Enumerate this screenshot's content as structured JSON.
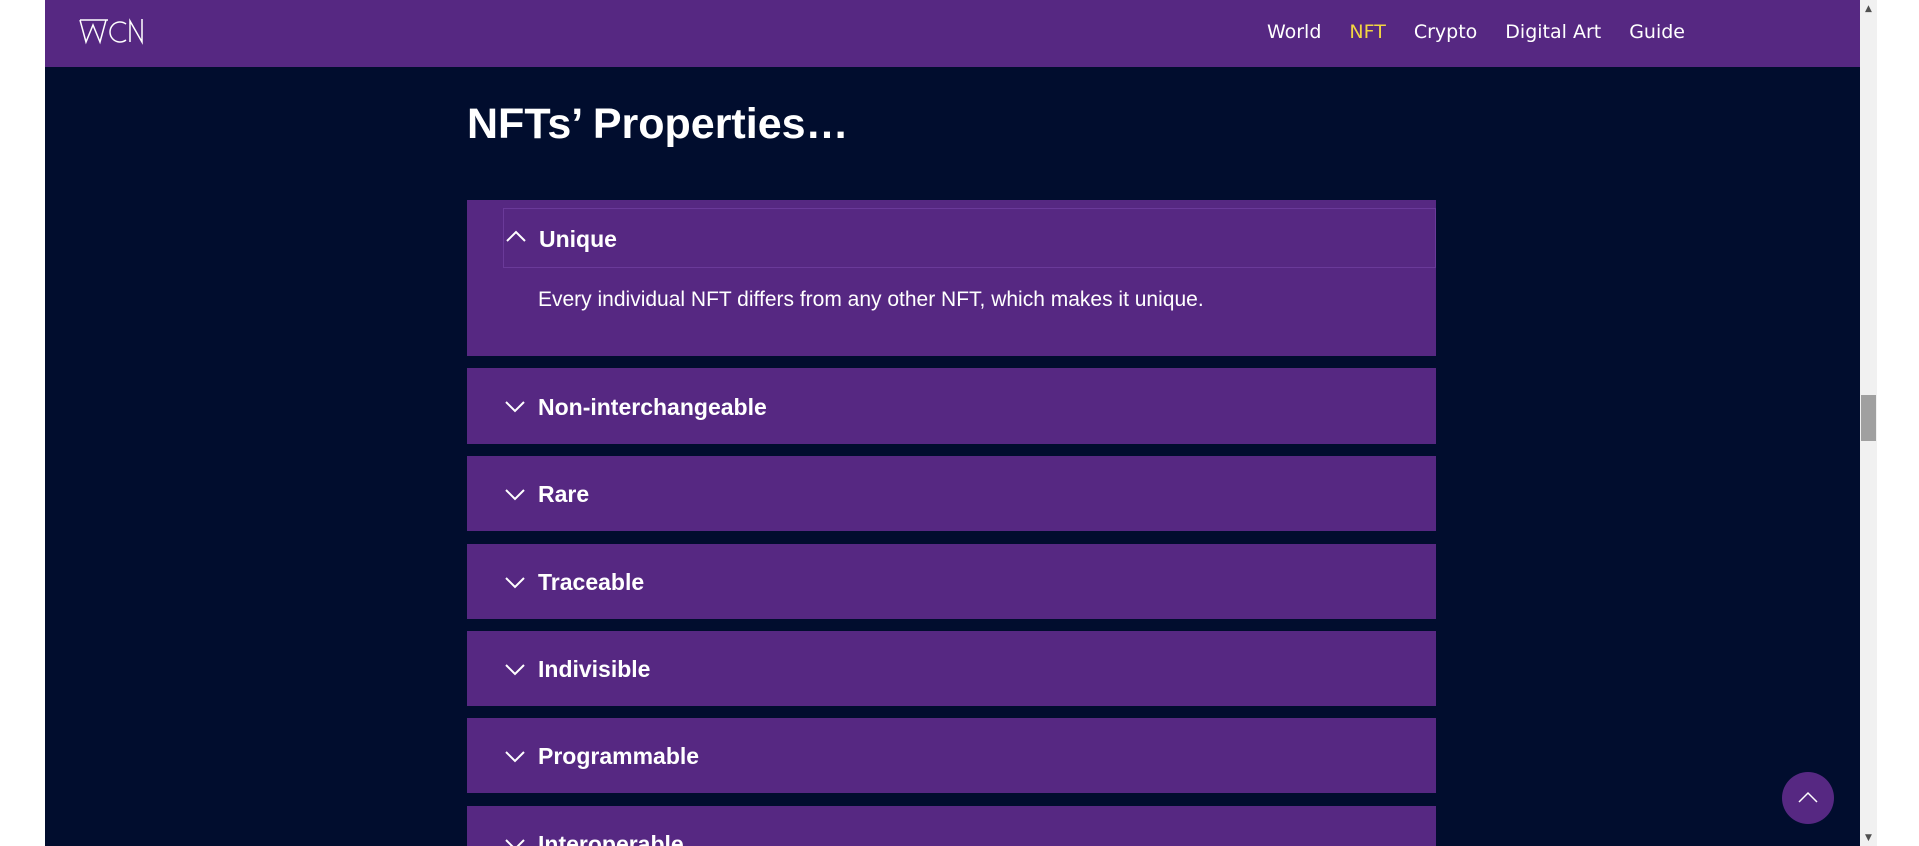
{
  "brand": {
    "logo_text": "WCN"
  },
  "nav": {
    "items": [
      {
        "label": "World",
        "active": false
      },
      {
        "label": "NFT",
        "active": true
      },
      {
        "label": "Crypto",
        "active": false
      },
      {
        "label": "Digital Art",
        "active": false
      },
      {
        "label": "Guide",
        "active": false
      }
    ],
    "active_color": "#f2d541"
  },
  "main": {
    "heading": "NFTs’ Properties…",
    "accordion": [
      {
        "title": "Unique",
        "expanded": true,
        "content": "Every individual NFT differs from any other NFT, which makes it unique."
      },
      {
        "title": "Non-interchangeable",
        "expanded": false
      },
      {
        "title": "Rare",
        "expanded": false
      },
      {
        "title": "Traceable",
        "expanded": false
      },
      {
        "title": "Indivisible",
        "expanded": false
      },
      {
        "title": "Programmable",
        "expanded": false
      },
      {
        "title": "Interoperable",
        "expanded": false
      }
    ]
  },
  "icons": {
    "logo": "wcn-logo",
    "expanded": "chevron-up-icon",
    "collapsed": "chevron-down-icon",
    "back_to_top": "arrow-up-icon"
  },
  "colors": {
    "background": "#010d2e",
    "accent": "#562882",
    "text": "#ffffff"
  }
}
